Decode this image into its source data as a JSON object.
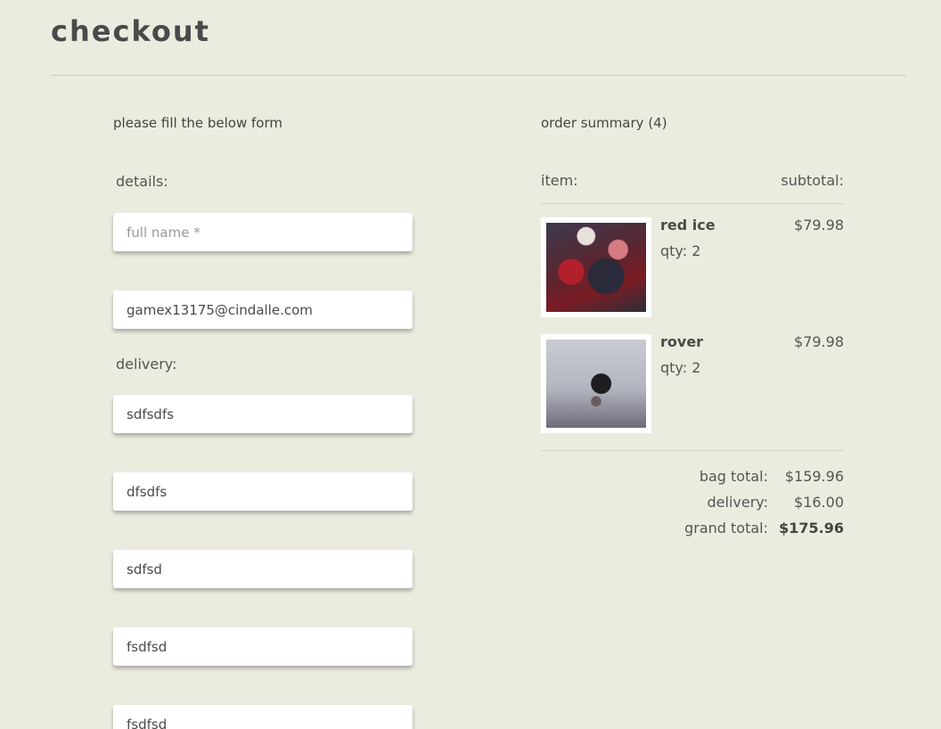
{
  "page": {
    "title": "checkout"
  },
  "form": {
    "intro": "please fill the below form",
    "details_label": "details:",
    "full_name": {
      "value": "",
      "placeholder": "full name *"
    },
    "email": {
      "value": "gamex13175@cindalle.com"
    },
    "delivery_label": "delivery:",
    "delivery_fields": [
      "sdfsdfs",
      "dfsdfs",
      "sdfsd",
      "fsdfsd",
      "fsdfsd"
    ]
  },
  "summary": {
    "title": "order summary (4)",
    "item_header": "item:",
    "subtotal_header": "subtotal:",
    "items": [
      {
        "name": "red ice",
        "qty": "qty: 2",
        "price": "$79.98"
      },
      {
        "name": "rover",
        "qty": "qty: 2",
        "price": "$79.98"
      }
    ],
    "bag_total_label": "bag total:",
    "bag_total": "$159.96",
    "delivery_label": "delivery:",
    "delivery": "$16.00",
    "grand_total_label": "grand total:",
    "grand_total": "$175.96"
  }
}
